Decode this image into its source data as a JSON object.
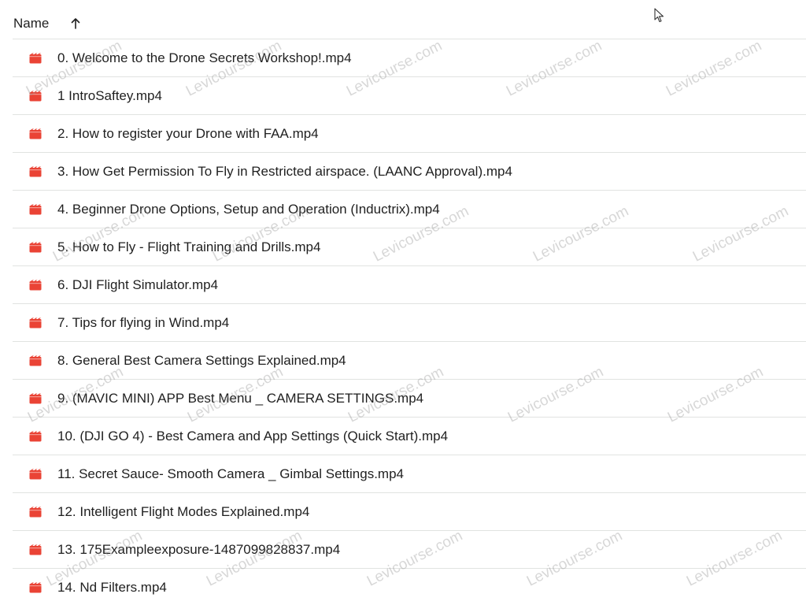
{
  "header": {
    "name_label": "Name",
    "sort_icon": "arrow-up-icon"
  },
  "files": [
    {
      "name": "0. Welcome to the Drone Secrets Workshop!.mp4",
      "icon": "video-file-icon"
    },
    {
      "name": "1 IntroSaftey.mp4",
      "icon": "video-file-icon"
    },
    {
      "name": "2. How to register your Drone with FAA.mp4",
      "icon": "video-file-icon"
    },
    {
      "name": "3. How Get Permission To Fly in Restricted airspace. (LAANC Approval).mp4",
      "icon": "video-file-icon"
    },
    {
      "name": "4. Beginner Drone Options, Setup and Operation (Inductrix).mp4",
      "icon": "video-file-icon"
    },
    {
      "name": "5. How to Fly - Flight Training and Drills.mp4",
      "icon": "video-file-icon"
    },
    {
      "name": "6. DJI Flight Simulator.mp4",
      "icon": "video-file-icon"
    },
    {
      "name": "7. Tips for flying in Wind.mp4",
      "icon": "video-file-icon"
    },
    {
      "name": "8. General Best Camera Settings Explained.mp4",
      "icon": "video-file-icon"
    },
    {
      "name": "9. (MAVIC MINI) APP Best Menu _ CAMERA SETTINGS.mp4",
      "icon": "video-file-icon"
    },
    {
      "name": "10. (DJI GO 4) - Best Camera and App Settings (Quick Start).mp4",
      "icon": "video-file-icon"
    },
    {
      "name": "11. Secret Sauce- Smooth Camera _ Gimbal Settings.mp4",
      "icon": "video-file-icon"
    },
    {
      "name": "12. Intelligent Flight Modes Explained.mp4",
      "icon": "video-file-icon"
    },
    {
      "name": "13. 175Exampleexposure-1487099828837.mp4",
      "icon": "video-file-icon"
    },
    {
      "name": "14. Nd Filters.mp4",
      "icon": "video-file-icon"
    }
  ],
  "watermark": {
    "text": "Levicourse.com"
  },
  "colors": {
    "video_icon": "#ea4335",
    "divider": "#e1e3e1",
    "text": "#1f1f1f"
  }
}
